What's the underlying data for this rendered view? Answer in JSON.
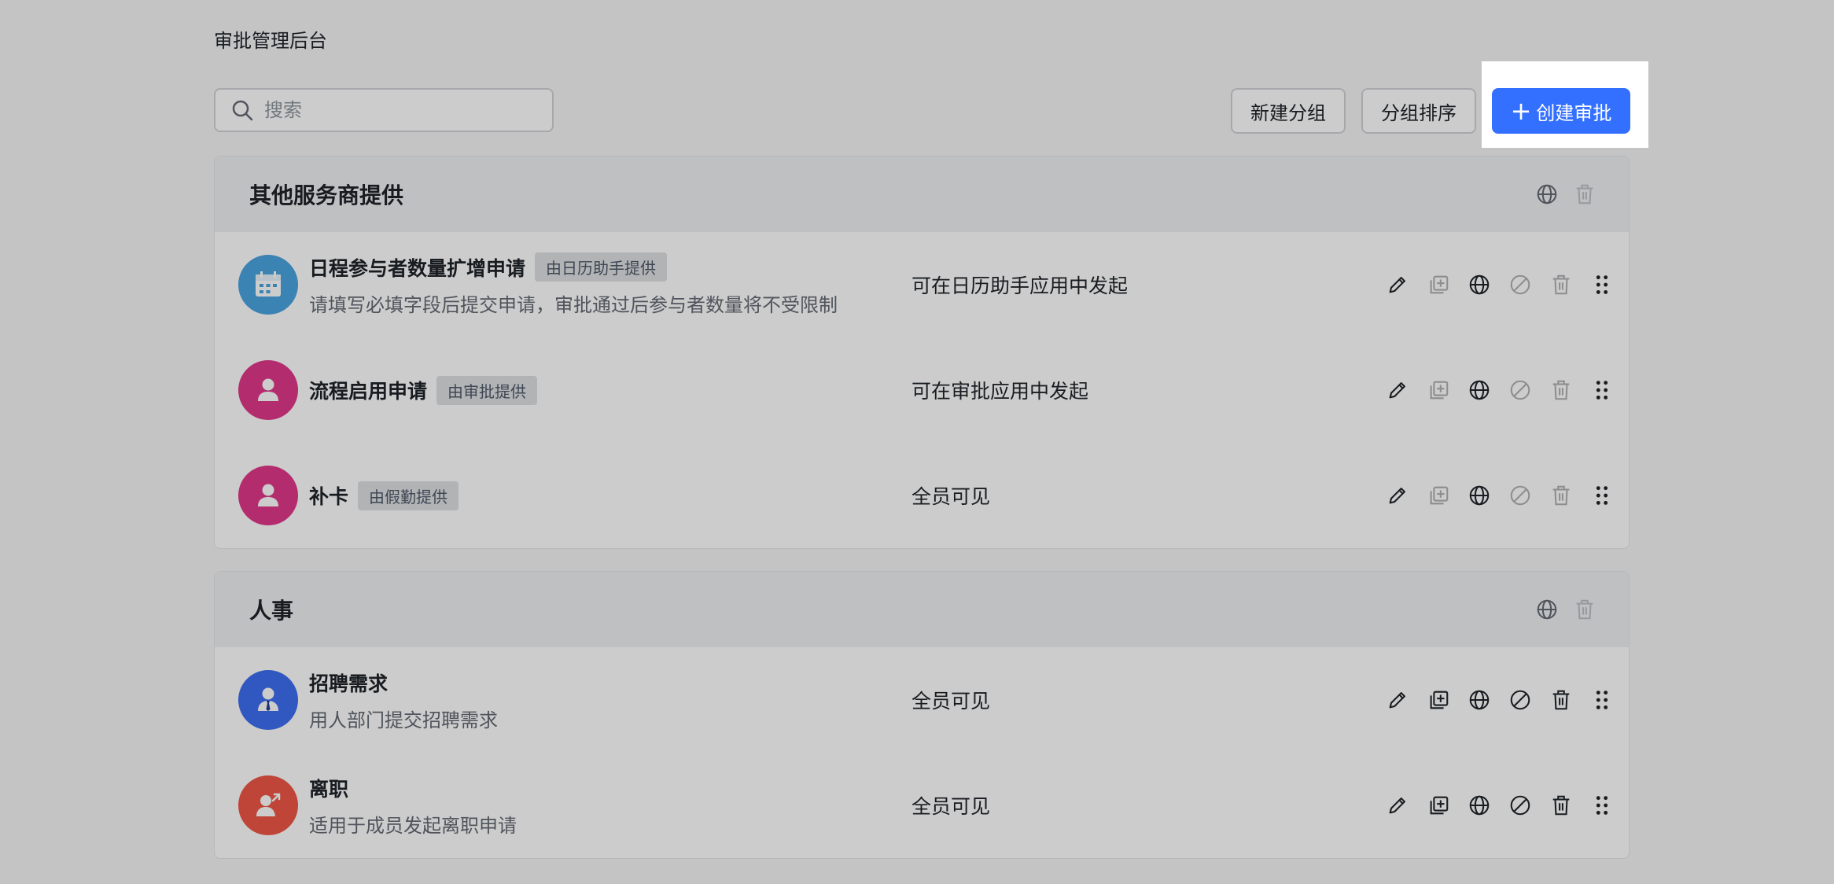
{
  "header": {
    "title": "审批管理后台"
  },
  "search": {
    "placeholder": "搜索"
  },
  "toolbar": {
    "new_group_label": "新建分组",
    "sort_group_label": "分组排序",
    "create_label": "创建审批"
  },
  "groups": [
    {
      "title": "其他服务商提供",
      "rows": [
        {
          "name": "日程参与者数量扩增申请",
          "badge": "由日历助手提供",
          "desc": "请填写必填字段后提交申请，审批通过后参与者数量将不受限制",
          "scope": "可在日历助手应用中发起",
          "avatar_icon": "calendar-icon",
          "avatar_color": "#4aa4df"
        },
        {
          "name": "流程启用申请",
          "badge": "由审批提供",
          "desc": "",
          "scope": "可在审批应用中发起",
          "avatar_icon": "person-icon",
          "avatar_color": "#e0378a"
        },
        {
          "name": "补卡",
          "badge": "由假勤提供",
          "desc": "",
          "scope": "全员可见",
          "avatar_icon": "person-icon",
          "avatar_color": "#e0378a"
        }
      ]
    },
    {
      "title": "人事",
      "rows": [
        {
          "name": "招聘需求",
          "badge": "",
          "desc": "用人部门提交招聘需求",
          "scope": "全员可见",
          "avatar_icon": "person-tie-icon",
          "avatar_color": "#3c6ff0"
        },
        {
          "name": "离职",
          "badge": "",
          "desc": "适用于成员发起离职申请",
          "scope": "全员可见",
          "avatar_icon": "person-leave-icon",
          "avatar_color": "#ef5747"
        }
      ]
    }
  ],
  "colors": {
    "primary": "#3370ff",
    "overlay": "rgba(0,0,0,0.2)"
  }
}
